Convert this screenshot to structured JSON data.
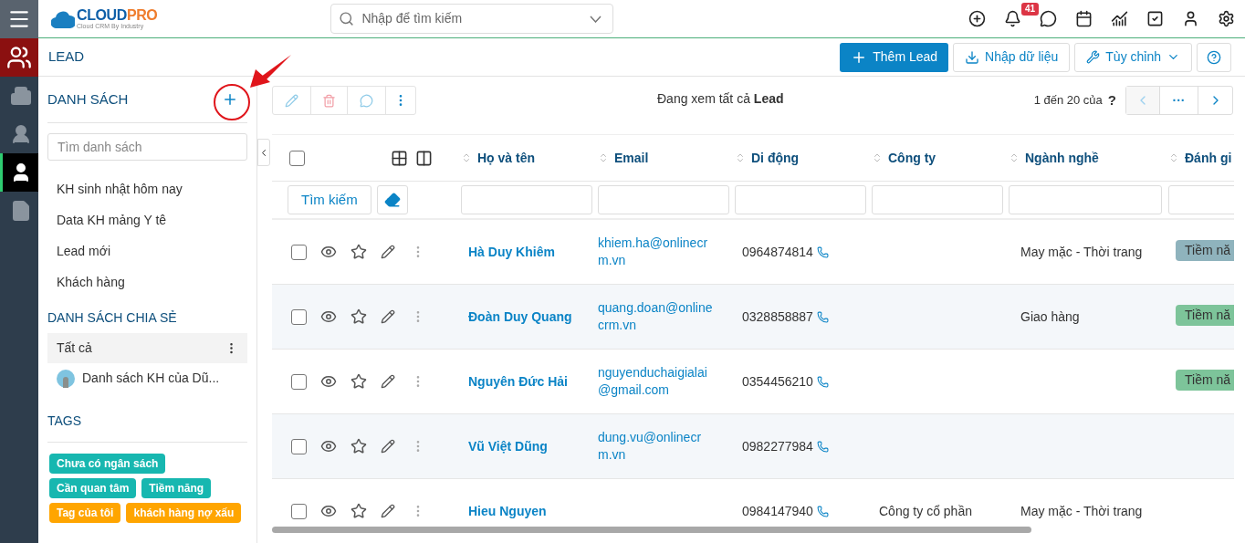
{
  "logo": {
    "text_1": "CLOUD",
    "text_2": "PRO",
    "tagline": "Cloud CRM By Industry"
  },
  "search": {
    "placeholder": "Nhập để tìm kiếm"
  },
  "notifications": {
    "count": "41"
  },
  "rail": [
    {
      "selected": false
    },
    {
      "selected": false
    },
    {
      "selected": true
    },
    {
      "selected": false
    }
  ],
  "page_title": "LEAD",
  "actions": [
    {
      "kind": "primary",
      "label": "Thêm Lead"
    },
    {
      "kind": "import",
      "label": "Nhập dữ liệu"
    },
    {
      "kind": "customize",
      "label": "Tùy chỉnh"
    },
    {
      "kind": "help"
    }
  ],
  "sidebar": {
    "heading": "DANH SÁCH",
    "search_placeholder": "Tìm danh sách",
    "lists": [
      "KH sinh nhật hôm nay",
      "Data KH mảng Y tê",
      "Lead mới",
      "Khách hàng"
    ],
    "shared_heading": "DANH SÁCH CHIA SẺ",
    "shared": [
      {
        "label": "Tất cả",
        "selected": true,
        "avatar": false
      },
      {
        "label": "Danh sách KH của Dũ...",
        "selected": false,
        "avatar": true
      }
    ],
    "tags_heading": "TAGS",
    "tags": [
      {
        "label": "Chưa có ngân sách",
        "color": "#17b7b0"
      },
      {
        "label": "Cần quan tâm",
        "color": "#17b7b0"
      },
      {
        "label": "Tiềm năng",
        "color": "#17b7b0"
      },
      {
        "label": "Tag của tôi",
        "color": "#ffa500"
      },
      {
        "label": "khách hàng nợ xấu",
        "color": "#ffa500"
      }
    ]
  },
  "viewing": "Đang xem tất cả **Lead**",
  "pagination": {
    "range": "1 đến 20 của",
    "unknown": "?",
    "more": "···"
  },
  "table": {
    "columns": [
      "Họ và tên",
      "Email",
      "Di động",
      "Công ty",
      "Ngành nghề",
      "Đánh gi"
    ],
    "search_button": "Tìm kiếm",
    "select_all": {
      "checked": false
    },
    "rows": [
      {
        "checked": false,
        "name": "Hà Duy Khiêm",
        "email": "khiem.ha@onlinecrm.vn",
        "phone": "0964874814",
        "company": "",
        "industry": "May mặc - Thời trang",
        "rating": {
          "label": "Tiềm nă",
          "color": "#8fb3bd"
        }
      },
      {
        "checked": false,
        "name": "Đoàn Duy Quang",
        "email": "quang.doan@onlinecrm.vn",
        "phone": "0328858887",
        "company": "",
        "industry": "Giao hàng",
        "rating": {
          "label": "Tiềm nă",
          "color": "#7dc49a"
        }
      },
      {
        "checked": false,
        "name": "Nguyên Đức Hải",
        "email": "nguyenduchaigialai@gmail.com",
        "phone": "0354456210",
        "company": "",
        "industry": "",
        "rating": {
          "label": "Tiềm nă",
          "color": "#7dc49a"
        }
      },
      {
        "checked": false,
        "name": "Vũ Việt Dũng",
        "email": "dung.vu@onlinecrm.vn",
        "phone": "0982277984",
        "company": "",
        "industry": ""
      },
      {
        "checked": false,
        "name": "Hieu Nguyen",
        "email": "",
        "phone": "0984147940",
        "company": "Công ty cổ phần",
        "industry": "May mặc - Thời trang"
      }
    ]
  }
}
